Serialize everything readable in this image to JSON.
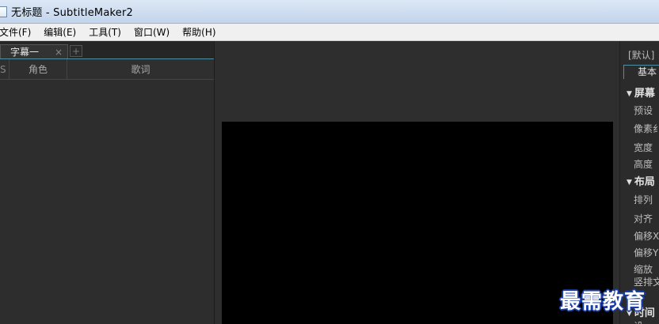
{
  "window": {
    "title": "无标题 - SubtitleMaker2"
  },
  "menu": {
    "items": [
      "文件(F)",
      "编辑(E)",
      "工具(T)",
      "窗口(W)",
      "帮助(H)"
    ]
  },
  "subtitle_panel": {
    "tab_label": "字幕一",
    "tab_close": "×",
    "tab_add": "+",
    "columns": {
      "s": "S",
      "role": "角色",
      "lyrics": "歌词"
    }
  },
  "properties_panel": {
    "preset": "[默认]",
    "tab_basic": "基本",
    "sections": {
      "screen": "屏幕",
      "layout": "布局",
      "time": "时间"
    },
    "fields": {
      "preset": "预设",
      "pixel": "像素纟",
      "width": "宽度",
      "height": "高度",
      "arrange": "排列",
      "align": "对齐",
      "offset_x": "偏移X",
      "offset_y": "偏移Y",
      "scale": "缩放",
      "vertical": "竖排文",
      "extra": "设"
    }
  },
  "watermark": "最需教育"
}
